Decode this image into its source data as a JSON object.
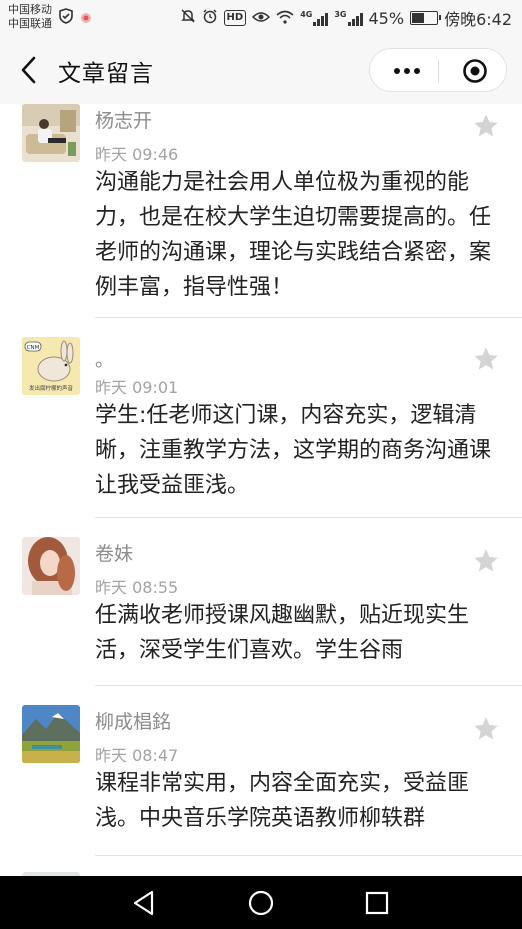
{
  "status_bar": {
    "carrier_1": "中国移动",
    "carrier_2": "中国联通",
    "network_4g": "4G",
    "network_3g": "3G",
    "battery_percent_text": "45%",
    "battery_level": 0.45,
    "time": "傍晚6:42",
    "icons": [
      "shield-icon",
      "notification-icon",
      "mute-icon",
      "alarm-icon",
      "hd-icon",
      "eye-icon",
      "wifi-icon",
      "signal-icon",
      "battery-icon"
    ],
    "hd_label": "HD"
  },
  "header": {
    "title": "文章留言",
    "back_icon": "chevron-left-icon",
    "more_icon": "more-dots-icon",
    "close_icon": "target-icon"
  },
  "comments": [
    {
      "nickname": "杨志开",
      "time": "昨天 09:46",
      "content": "沟通能力是社会用人单位极为重视的能力，也是在校大学生迫切需要提高的。任老师的沟通课，理论与实践结合紧密，案例丰富，指导性强！",
      "avatar": "person-reading-avatar"
    },
    {
      "nickname": "。",
      "time": "昨天 09:01",
      "content": "学生:任老师这门课，内容充实，逻辑清晰，注重教学方法，这学期的商务沟通课让我受益匪浅。",
      "avatar": "rabbit-avatar",
      "avatar_badge": "CNM",
      "avatar_caption": "发出腐柠檬的声音"
    },
    {
      "nickname": "卷妹",
      "time": "昨天 08:55",
      "content": "任满收老师授课风趣幽默，贴近现实生活，深受学生们喜欢。学生谷雨",
      "avatar": "girl-portrait-avatar"
    },
    {
      "nickname": "柳成椙銘",
      "time": "昨天 08:47",
      "content": "课程非常实用，内容全面充实，受益匪浅。中央音乐学院英语教师柳轶群",
      "avatar": "landscape-avatar"
    }
  ],
  "colors": {
    "bar_background": "#f7f7f7",
    "nickname": "#8c8c8c",
    "time": "#a3a3a3",
    "content": "#222222",
    "star": "#d4d4d4",
    "navbar": "#000000"
  },
  "navigation": {
    "back_icon": "triangle-back-icon",
    "home_icon": "circle-home-icon",
    "recents_icon": "square-recents-icon"
  }
}
